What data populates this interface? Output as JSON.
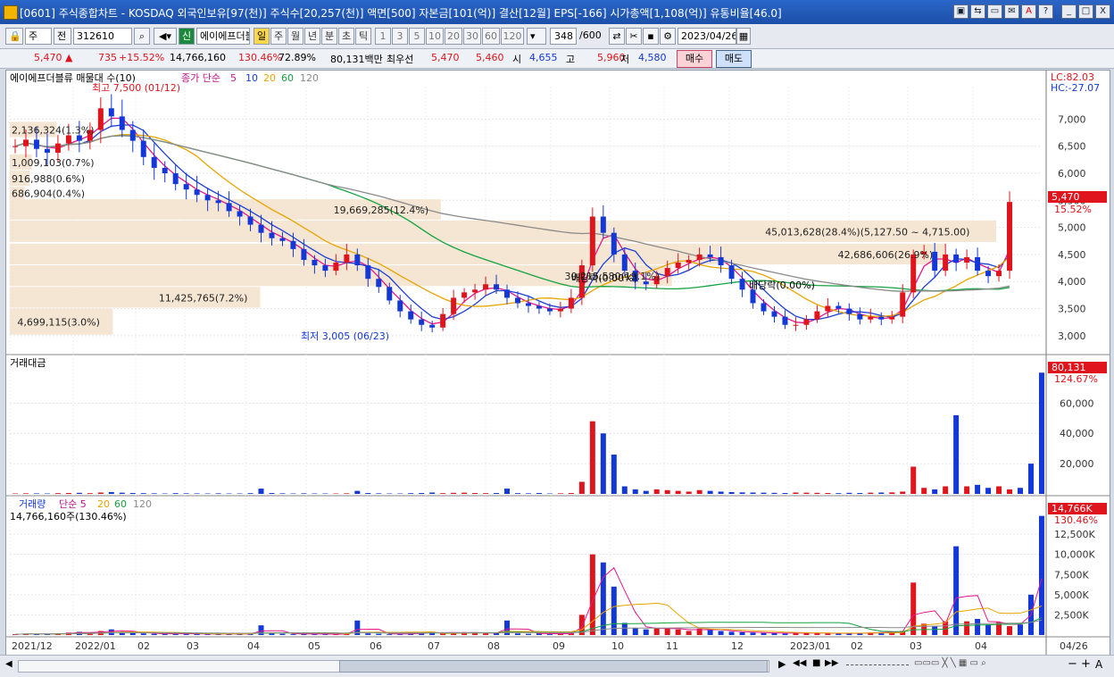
{
  "window": {
    "title": "[0601] 주식종합차트 - KOSDAQ 외국인보유[97(천)] 주식수[20,257(천)] 액면[500] 자본금[101(억)] 결산[12월] EPS[-166] 시가총액[1,108(억)] 유통비율[46.0]",
    "buttons": [
      "▣",
      "⇆",
      "▭",
      "✉",
      "A",
      "?",
      "_",
      "□",
      "X"
    ]
  },
  "toolbar": {
    "market": "주",
    "prev_label": "전",
    "code": "312610",
    "badge": "신",
    "name": "에이에프더블",
    "periods": [
      "일",
      "주",
      "월",
      "년",
      "분",
      "초",
      "틱"
    ],
    "active_period": "일",
    "minutes": [
      "1",
      "3",
      "5",
      "10",
      "20",
      "30",
      "60",
      "120"
    ],
    "count": "348",
    "count_total": "/600",
    "date": "2023/04/26"
  },
  "quote": {
    "price": "5,470",
    "arrow": "▲",
    "change": "735",
    "change_pct": "+15.52%",
    "volume": "14,766,160",
    "volume_ratio": "130.46%",
    "turnover": "72.89%",
    "amount": "80,131백만",
    "pref_label": "최우선",
    "ask": "5,470",
    "bid": "5,460",
    "open_label": "시",
    "open": "4,655",
    "high_label": "고",
    "high": "5,960",
    "low_label": "저",
    "low": "4,580",
    "buy": "매수",
    "sell": "매도"
  },
  "chart_data": [
    {
      "type": "candlestick",
      "title": "에이에프더블류 매물대 수(10)",
      "legend_prefix": "종가 단순",
      "ma_periods": [
        "5",
        "10",
        "20",
        "60",
        "120"
      ],
      "ma_colors": [
        "#e6158c",
        "#1d3fd6",
        "#e8a400",
        "#15a341",
        "#8a8a8a"
      ],
      "y_ticks": [
        3000,
        3500,
        4000,
        4500,
        5000,
        5500,
        6000,
        6500,
        7000
      ],
      "ylim": [
        2750,
        7600
      ],
      "x_ticks": [
        "2021/12",
        "2022/01",
        "02",
        "03",
        "04",
        "05",
        "06",
        "07",
        "08",
        "09",
        "10",
        "11",
        "12",
        "2023/01",
        "02",
        "03",
        "04",
        "04/26"
      ],
      "last_price": "5,470",
      "last_pct": "15.52%",
      "lc": "LC:82.03",
      "hc": "HC:-27.07",
      "high_note": "최고 7,500 (01/12)",
      "low_note": "최저 3,005 (06/23)",
      "dividend_1": "배당락(0.00%)",
      "dividend_2": "배당락(0.00%)",
      "volume_profile": [
        {
          "label": "686,904(0.4%)",
          "low": 5500,
          "high": 5750,
          "value": 686904
        },
        {
          "label": "916,988(0.6%)",
          "low": 5750,
          "high": 6050,
          "value": 916988
        },
        {
          "label": "1,009,103(0.7%)",
          "low": 6050,
          "high": 6350,
          "value": 1009103
        },
        {
          "label": "2,136,324(1.3%)",
          "low": 6650,
          "high": 6950,
          "value": 2136324
        },
        {
          "label": "4,699,115(3.0%)",
          "low": 3000,
          "high": 3500,
          "value": 4699115
        },
        {
          "label": "11,425,765(7.2%)",
          "low": 3500,
          "high": 3900,
          "value": 11425765
        },
        {
          "label": "30,215,580(19.1%)",
          "low": 3900,
          "high": 4300,
          "value": 30215580
        },
        {
          "label": "42,686,606(26.9%)",
          "low": 4300,
          "high": 4700,
          "value": 42686606
        },
        {
          "label": "45,013,628(28.4%)(5,127.50 ~ 4,715.00)",
          "low": 4715,
          "high": 5127.5,
          "value": 45013628
        },
        {
          "label": "19,669,285(12.4%)",
          "low": 5127.5,
          "high": 5520,
          "value": 19669285
        }
      ],
      "closes": [
        6500,
        6620,
        6450,
        6380,
        6550,
        6700,
        6600,
        6800,
        7200,
        7050,
        6800,
        6600,
        6300,
        6100,
        6000,
        5800,
        5700,
        5600,
        5500,
        5450,
        5300,
        5200,
        5050,
        4900,
        4800,
        4750,
        4600,
        4400,
        4300,
        4200,
        4350,
        4500,
        4300,
        4050,
        3900,
        3650,
        3450,
        3300,
        3200,
        3150,
        3400,
        3700,
        3800,
        3850,
        3950,
        3850,
        3700,
        3600,
        3550,
        3500,
        3450,
        3500,
        3700,
        4300,
        5200,
        4900,
        4500,
        4200,
        4000,
        3950,
        4100,
        4250,
        4350,
        4400,
        4500,
        4450,
        4300,
        4050,
        3850,
        3600,
        3450,
        3350,
        3200,
        3200,
        3300,
        3450,
        3550,
        3500,
        3400,
        3300,
        3350,
        3300,
        3350,
        3800,
        4500,
        4550,
        4200,
        4500,
        4350,
        4450,
        4200,
        4100,
        4200,
        5470
      ],
      "avg_volume": [
        {
          "name": "거래대금",
          "ticks": [
            "20,000",
            "40,000",
            "60,000"
          ],
          "ylim": [
            0,
            85000
          ],
          "last": "80,131",
          "last_pct": "124.67%"
        },
        {
          "name": "거래량",
          "ticks": [
            "2,500K",
            "5,000K",
            "7,500K",
            "10,000K",
            "12,500K"
          ],
          "ylim": [
            0,
            15500
          ],
          "last": "14,766K",
          "last_pct": "130.46%",
          "header_value": "14,766,160주(130.46%)"
        }
      ],
      "amount_bars": [
        300,
        400,
        350,
        300,
        500,
        600,
        700,
        500,
        900,
        1200,
        800,
        600,
        500,
        400,
        300,
        500,
        400,
        350,
        300,
        400,
        300,
        300,
        500,
        3500,
        600,
        400,
        300,
        400,
        300,
        300,
        300,
        400,
        2000,
        600,
        400,
        300,
        300,
        500,
        600,
        900,
        500,
        700,
        800,
        600,
        500,
        600,
        3500,
        500,
        400,
        600,
        300,
        400,
        600,
        8000,
        48000,
        40000,
        26000,
        5000,
        3000,
        2000,
        3000,
        2500,
        2000,
        1500,
        2500,
        2000,
        1500,
        1200,
        1000,
        900,
        800,
        700,
        600,
        900,
        800,
        700,
        600,
        500,
        700,
        600,
        800,
        900,
        1000,
        1500,
        18000,
        4000,
        3000,
        5000,
        52000,
        5000,
        6000,
        4000,
        5000,
        3000,
        4000,
        20000,
        80131
      ],
      "volume_bars": [
        100,
        150,
        120,
        100,
        200,
        300,
        400,
        200,
        500,
        700,
        400,
        300,
        200,
        150,
        120,
        200,
        150,
        120,
        100,
        150,
        100,
        100,
        200,
        1200,
        200,
        150,
        100,
        150,
        100,
        100,
        100,
        150,
        1800,
        200,
        150,
        100,
        100,
        200,
        250,
        400,
        200,
        300,
        350,
        250,
        200,
        250,
        1800,
        200,
        150,
        250,
        100,
        150,
        250,
        2500,
        10000,
        9000,
        6000,
        1500,
        900,
        700,
        900,
        800,
        700,
        500,
        800,
        700,
        500,
        400,
        350,
        300,
        250,
        250,
        200,
        300,
        250,
        250,
        200,
        180,
        250,
        200,
        300,
        350,
        400,
        500,
        6500,
        1400,
        1100,
        1700,
        11000,
        1700,
        2000,
        1300,
        1600,
        1100,
        1300,
        5000,
        14766
      ]
    }
  ],
  "bottom": {
    "scroll_nav": [
      "▶",
      "◀◀",
      "■",
      "▶▶"
    ],
    "tools": [
      "−",
      "+",
      "A"
    ]
  }
}
